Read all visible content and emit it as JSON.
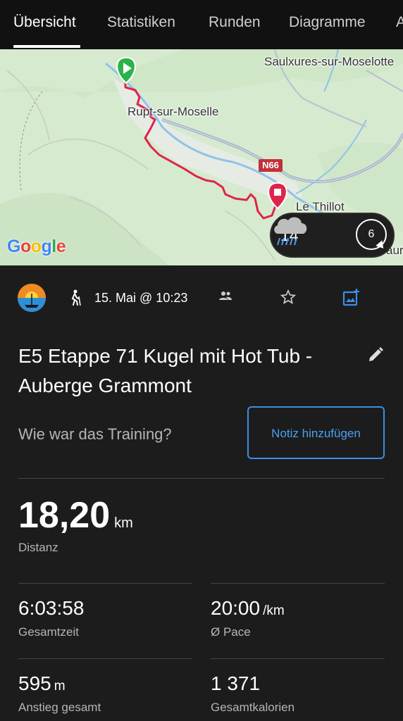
{
  "tabs": [
    {
      "label": "Übersicht",
      "active": true
    },
    {
      "label": "Statistiken"
    },
    {
      "label": "Runden"
    },
    {
      "label": "Diagramme"
    },
    {
      "label": "A"
    }
  ],
  "map": {
    "places": [
      "Saulxures-sur-Moselotte",
      "Rupt-sur-Moselle",
      "Le Thillot",
      "aurio"
    ],
    "road": "N66",
    "logo": "Google",
    "weather": {
      "temperature": "14°",
      "wind_speed": "6",
      "icon": "rain-cloud-icon"
    }
  },
  "activity": {
    "type_icon": "hiking-icon",
    "datetime": "15. Mai @ 10:23",
    "title": "E5 Etappe 71 Kugel mit Hot Tub - Auberge Grammont",
    "question": "Wie war das Training?",
    "note_button": "Notiz hinzufügen"
  },
  "stats": {
    "distance": {
      "value": "18,20",
      "unit": "km",
      "label": "Distanz"
    },
    "total_time": {
      "value": "6:03:58",
      "label": "Gesamtzeit"
    },
    "pace": {
      "value": "20:00",
      "unit": "/km",
      "label": "Ø Pace"
    },
    "ascent": {
      "value": "595",
      "unit": "m",
      "label": "Anstieg gesamt"
    },
    "calories": {
      "value": "1 371",
      "label": "Gesamtkalorien"
    }
  },
  "colors": {
    "accent": "#3b8fe3",
    "route": "#e0234a",
    "background": "#1c1c1c"
  }
}
